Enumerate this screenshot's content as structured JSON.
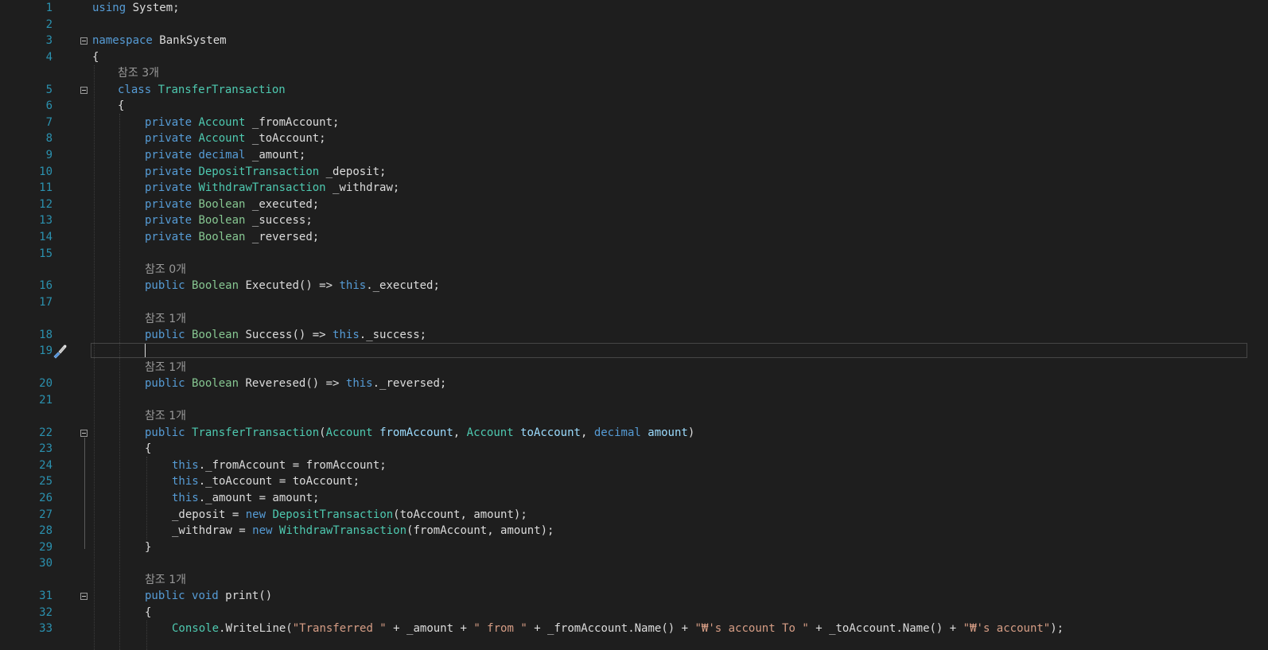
{
  "editor": {
    "lines": [
      {
        "n": "1",
        "lens": "",
        "indent": 0,
        "tokens": [
          [
            "kw",
            "using"
          ],
          [
            "plain",
            " System;"
          ]
        ]
      },
      {
        "n": "2",
        "lens": "",
        "indent": 0,
        "tokens": []
      },
      {
        "n": "3",
        "lens": "",
        "indent": 0,
        "fold": true,
        "tokens": [
          [
            "kw",
            "namespace"
          ],
          [
            "plain",
            " BankSystem"
          ]
        ]
      },
      {
        "n": "4",
        "lens": "",
        "indent": 0,
        "tokens": [
          [
            "plain",
            "{"
          ]
        ]
      },
      {
        "n": "5",
        "lens": "참조 3개",
        "indent": 1,
        "fold": true,
        "tokens": [
          [
            "kw",
            "class"
          ],
          [
            "plain",
            " "
          ],
          [
            "type",
            "TransferTransaction"
          ]
        ]
      },
      {
        "n": "6",
        "lens": "",
        "indent": 1,
        "tokens": [
          [
            "plain",
            "{"
          ]
        ]
      },
      {
        "n": "7",
        "lens": "",
        "indent": 2,
        "tokens": [
          [
            "kw",
            "private"
          ],
          [
            "plain",
            " "
          ],
          [
            "type",
            "Account"
          ],
          [
            "plain",
            " _fromAccount;"
          ]
        ]
      },
      {
        "n": "8",
        "lens": "",
        "indent": 2,
        "tokens": [
          [
            "kw",
            "private"
          ],
          [
            "plain",
            " "
          ],
          [
            "type",
            "Account"
          ],
          [
            "plain",
            " _toAccount;"
          ]
        ]
      },
      {
        "n": "9",
        "lens": "",
        "indent": 2,
        "tokens": [
          [
            "kw",
            "private"
          ],
          [
            "plain",
            " "
          ],
          [
            "kw",
            "decimal"
          ],
          [
            "plain",
            " _amount;"
          ]
        ]
      },
      {
        "n": "10",
        "lens": "",
        "indent": 2,
        "tokens": [
          [
            "kw",
            "private"
          ],
          [
            "plain",
            " "
          ],
          [
            "type",
            "DepositTransaction"
          ],
          [
            "plain",
            " _deposit;"
          ]
        ]
      },
      {
        "n": "11",
        "lens": "",
        "indent": 2,
        "tokens": [
          [
            "kw",
            "private"
          ],
          [
            "plain",
            " "
          ],
          [
            "type",
            "WithdrawTransaction"
          ],
          [
            "plain",
            " _withdraw;"
          ]
        ]
      },
      {
        "n": "12",
        "lens": "",
        "indent": 2,
        "tokens": [
          [
            "kw",
            "private"
          ],
          [
            "plain",
            " "
          ],
          [
            "type2",
            "Boolean"
          ],
          [
            "plain",
            " _executed;"
          ]
        ]
      },
      {
        "n": "13",
        "lens": "",
        "indent": 2,
        "tokens": [
          [
            "kw",
            "private"
          ],
          [
            "plain",
            " "
          ],
          [
            "type2",
            "Boolean"
          ],
          [
            "plain",
            " _success;"
          ]
        ]
      },
      {
        "n": "14",
        "lens": "",
        "indent": 2,
        "tokens": [
          [
            "kw",
            "private"
          ],
          [
            "plain",
            " "
          ],
          [
            "type2",
            "Boolean"
          ],
          [
            "plain",
            " _reversed;"
          ]
        ]
      },
      {
        "n": "15",
        "lens": "",
        "indent": 2,
        "tokens": []
      },
      {
        "n": "16",
        "lens": "참조 0개",
        "indent": 2,
        "tokens": [
          [
            "kw",
            "public"
          ],
          [
            "plain",
            " "
          ],
          [
            "type2",
            "Boolean"
          ],
          [
            "plain",
            " Executed() => "
          ],
          [
            "kw",
            "this"
          ],
          [
            "plain",
            "._executed;"
          ]
        ]
      },
      {
        "n": "17",
        "lens": "",
        "indent": 2,
        "tokens": []
      },
      {
        "n": "18",
        "lens": "참조 1개",
        "indent": 2,
        "tokens": [
          [
            "kw",
            "public"
          ],
          [
            "plain",
            " "
          ],
          [
            "type2",
            "Boolean"
          ],
          [
            "plain",
            " Success() => "
          ],
          [
            "kw",
            "this"
          ],
          [
            "plain",
            "._success;"
          ]
        ]
      },
      {
        "n": "19",
        "lens": "",
        "indent": 2,
        "tokens": []
      },
      {
        "n": "20",
        "lens": "참조 1개",
        "indent": 2,
        "tokens": [
          [
            "kw",
            "public"
          ],
          [
            "plain",
            " "
          ],
          [
            "type2",
            "Boolean"
          ],
          [
            "plain",
            " Reveresed() => "
          ],
          [
            "kw",
            "this"
          ],
          [
            "plain",
            "._reversed;"
          ]
        ]
      },
      {
        "n": "21",
        "lens": "",
        "indent": 2,
        "tokens": []
      },
      {
        "n": "22",
        "lens": "참조 1개",
        "indent": 2,
        "fold": true,
        "tokens": [
          [
            "kw",
            "public"
          ],
          [
            "plain",
            " "
          ],
          [
            "type",
            "TransferTransaction"
          ],
          [
            "plain",
            "("
          ],
          [
            "type",
            "Account"
          ],
          [
            "plain",
            " "
          ],
          [
            "param",
            "fromAccount"
          ],
          [
            "plain",
            ", "
          ],
          [
            "type",
            "Account"
          ],
          [
            "plain",
            " "
          ],
          [
            "param",
            "toAccount"
          ],
          [
            "plain",
            ", "
          ],
          [
            "kw",
            "decimal"
          ],
          [
            "plain",
            " "
          ],
          [
            "param",
            "amount"
          ],
          [
            "plain",
            ")"
          ]
        ]
      },
      {
        "n": "23",
        "lens": "",
        "indent": 2,
        "tokens": [
          [
            "plain",
            "{"
          ]
        ]
      },
      {
        "n": "24",
        "lens": "",
        "indent": 3,
        "tokens": [
          [
            "kw",
            "this"
          ],
          [
            "plain",
            "._fromAccount = fromAccount;"
          ]
        ]
      },
      {
        "n": "25",
        "lens": "",
        "indent": 3,
        "tokens": [
          [
            "kw",
            "this"
          ],
          [
            "plain",
            "._toAccount = toAccount;"
          ]
        ]
      },
      {
        "n": "26",
        "lens": "",
        "indent": 3,
        "tokens": [
          [
            "kw",
            "this"
          ],
          [
            "plain",
            "._amount = amount;"
          ]
        ]
      },
      {
        "n": "27",
        "lens": "",
        "indent": 3,
        "tokens": [
          [
            "plain",
            "_deposit = "
          ],
          [
            "kw",
            "new"
          ],
          [
            "plain",
            " "
          ],
          [
            "type",
            "DepositTransaction"
          ],
          [
            "plain",
            "(toAccount, amount);"
          ]
        ]
      },
      {
        "n": "28",
        "lens": "",
        "indent": 3,
        "tokens": [
          [
            "plain",
            "_withdraw = "
          ],
          [
            "kw",
            "new"
          ],
          [
            "plain",
            " "
          ],
          [
            "type",
            "WithdrawTransaction"
          ],
          [
            "plain",
            "(fromAccount, amount);"
          ]
        ]
      },
      {
        "n": "29",
        "lens": "",
        "indent": 2,
        "tokens": [
          [
            "plain",
            "}"
          ]
        ]
      },
      {
        "n": "30",
        "lens": "",
        "indent": 2,
        "tokens": []
      },
      {
        "n": "31",
        "lens": "참조 1개",
        "indent": 2,
        "fold": true,
        "tokens": [
          [
            "kw",
            "public"
          ],
          [
            "plain",
            " "
          ],
          [
            "kw",
            "void"
          ],
          [
            "plain",
            " print()"
          ]
        ]
      },
      {
        "n": "32",
        "lens": "",
        "indent": 2,
        "tokens": [
          [
            "plain",
            "{"
          ]
        ]
      },
      {
        "n": "33",
        "lens": "",
        "indent": 3,
        "tokens": [
          [
            "type",
            "Console"
          ],
          [
            "plain",
            ".WriteLine("
          ],
          [
            "str",
            "\"Transferred \""
          ],
          [
            "plain",
            " + _amount + "
          ],
          [
            "str",
            "\" from \""
          ],
          [
            "plain",
            " + _fromAccount.Name() + "
          ],
          [
            "str",
            "\"₩'s account To \""
          ],
          [
            "plain",
            " + _toAccount.Name() + "
          ],
          [
            "str",
            "\"₩'s account\""
          ],
          [
            "plain",
            ");"
          ]
        ]
      }
    ]
  },
  "colors": {
    "background": "#1e1e1e",
    "line_number": "#2b91af",
    "keyword": "#569cd6",
    "type": "#4ec9b0",
    "string": "#d69d85",
    "codelens": "#999999"
  },
  "icons": {
    "gutter_line_19": "paintbrush-icon"
  }
}
